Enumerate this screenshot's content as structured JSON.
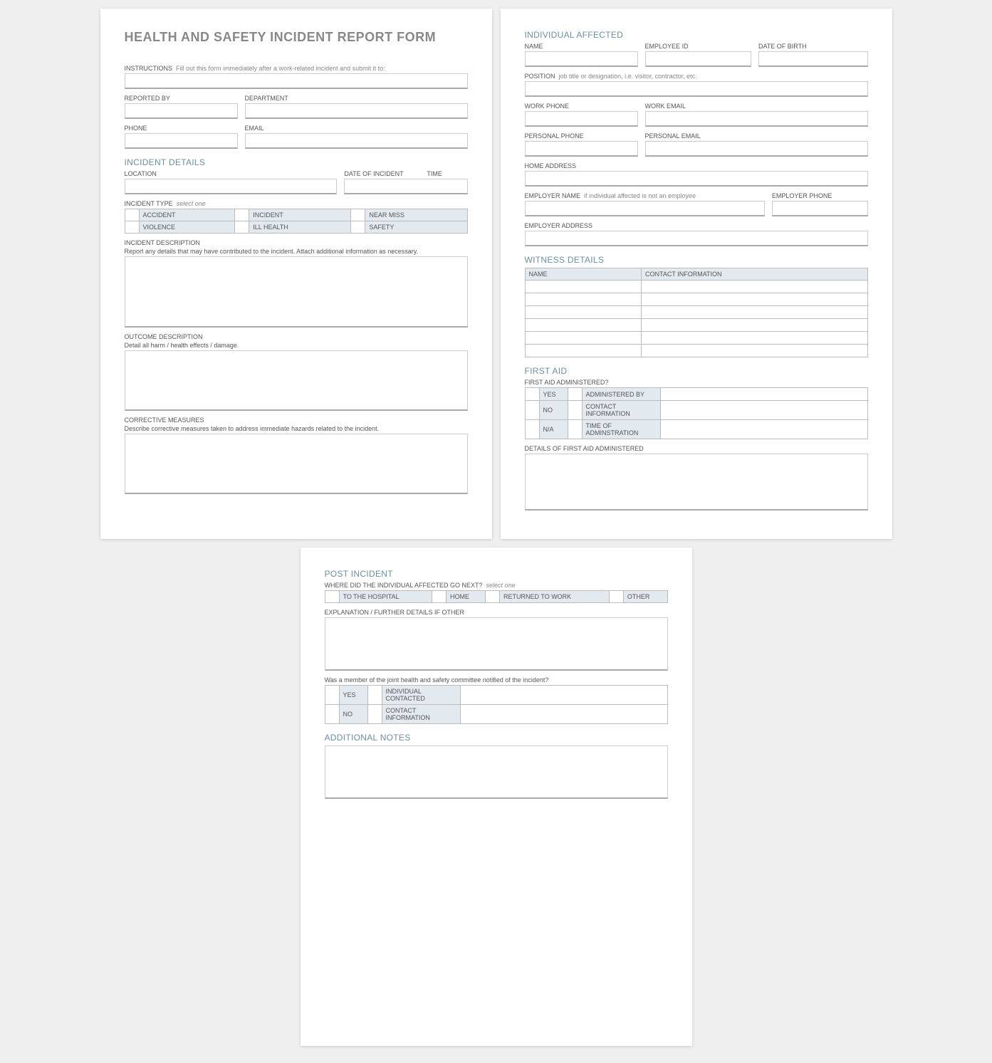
{
  "title": "HEALTH AND SAFETY INCIDENT REPORT FORM",
  "instr_label": "INSTRUCTIONS",
  "instr_sub": "Fill out this form immediately after a work-related incident and submit it to:",
  "reported_by": "REPORTED BY",
  "department": "DEPARTMENT",
  "phone": "PHONE",
  "email": "EMAIL",
  "inc_details_h": "INCIDENT DETAILS",
  "location": "LOCATION",
  "date_of_incident": "DATE OF INCIDENT",
  "time": "TIME",
  "incident_type_label": "INCIDENT TYPE",
  "select_one": "select one",
  "it": [
    "ACCIDENT",
    "INCIDENT",
    "NEAR MISS",
    "VIOLENCE",
    "ILL HEALTH",
    "SAFETY"
  ],
  "inc_desc_label": "INCIDENT DESCRIPTION",
  "inc_desc_sub": "Report any details that may have contributed to the incident.  Attach additional information as necessary.",
  "out_desc_label": "OUTCOME DESCRIPTION",
  "out_desc_sub": "Detail all harm / health effects / damage.",
  "corr_label": "CORRECTIVE MEASURES",
  "corr_sub": "Describe corrective measures taken to address immediate hazards related to the incident.",
  "ia_h": "INDIVIDUAL AFFECTED",
  "ia_name": "NAME",
  "ia_empid": "EMPLOYEE ID",
  "ia_dob": "DATE OF BIRTH",
  "ia_pos_label": "POSITION",
  "ia_pos_sub": "job title or designation, i.e. visitor, contractor, etc.",
  "ia_workphone": "WORK PHONE",
  "ia_workemail": "WORK EMAIL",
  "ia_persphone": "PERSONAL PHONE",
  "ia_persemail": "PERSONAL EMAIL",
  "ia_homeaddr": "HOME ADDRESS",
  "ia_empname_label": "EMPLOYER NAME",
  "ia_empname_sub": "if individual affected is not an employee",
  "ia_empphone": "EMPLOYER PHONE",
  "ia_empaddr": "EMPLOYER ADDRESS",
  "wd_h": "WITNESS DETAILS",
  "wd_name": "NAME",
  "wd_contact": "CONTACT INFORMATION",
  "fa_h": "FIRST AID",
  "fa_q": "FIRST AID ADMINISTERED?",
  "fa_yes": "YES",
  "fa_no": "NO",
  "fa_na": "N/A",
  "fa_admin_by": "ADMINISTERED BY",
  "fa_contact": "CONTACT INFORMATION",
  "fa_time": "TIME OF ADMINSTRATION",
  "fa_details": "DETAILS OF FIRST AID ADMINISTERED",
  "pi_h": "POST INCIDENT",
  "pi_q_label": "WHERE DID THE INDIVIDUAL AFFECTED GO NEXT?",
  "pi_opt": [
    "TO THE HOSPITAL",
    "HOME",
    "RETURNED TO WORK",
    "OTHER"
  ],
  "pi_expl": "EXPLANATION / FURTHER DETAILS IF OTHER",
  "pi_committee_q": "Was a member of the joint health and safety committee notified of the incident?",
  "pi_yes": "YES",
  "pi_no": "NO",
  "pi_indiv": "INDIVIDUAL CONTACTED",
  "pi_contact": "CONTACT INFORMATION",
  "an_h": "ADDITIONAL NOTES"
}
